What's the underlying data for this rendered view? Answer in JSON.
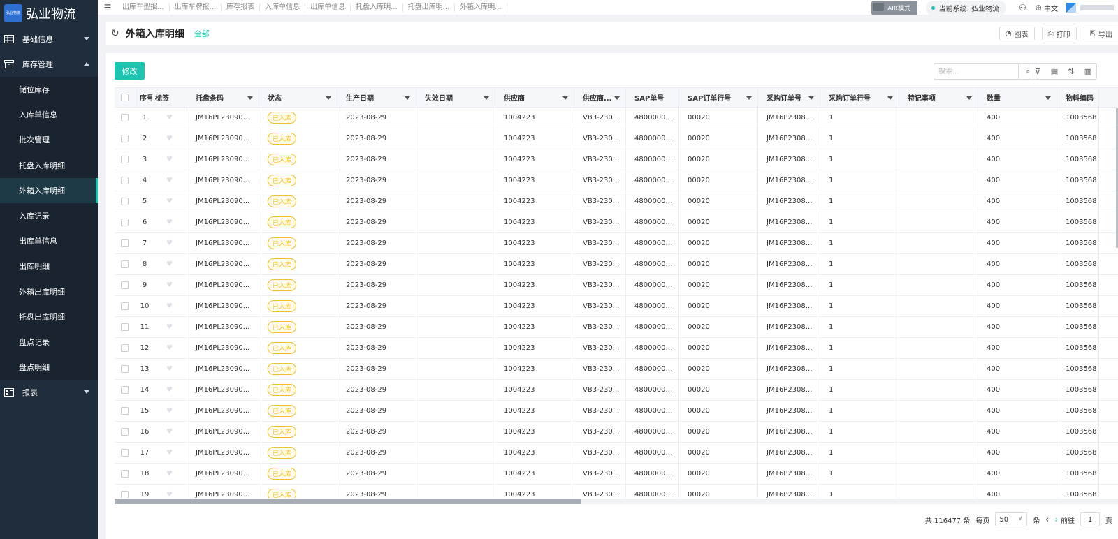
{
  "app": {
    "logo_mark": "弘业物流",
    "name": "弘业物流"
  },
  "sidebar": {
    "groups": [
      {
        "label": "基础信息",
        "expanded": false
      },
      {
        "label": "库存管理",
        "expanded": true
      },
      {
        "label": "报表",
        "expanded": false
      }
    ],
    "items": [
      {
        "label": "储位库存"
      },
      {
        "label": "入库单信息"
      },
      {
        "label": "批次管理"
      },
      {
        "label": "托盘入库明细"
      },
      {
        "label": "外箱入库明细",
        "active": true
      },
      {
        "label": "入库记录"
      },
      {
        "label": "出库单信息"
      },
      {
        "label": "出库明细"
      },
      {
        "label": "外箱出库明细"
      },
      {
        "label": "托盘出库明细"
      },
      {
        "label": "盘点记录"
      },
      {
        "label": "盘点明细"
      }
    ]
  },
  "topbar": {
    "tabs": [
      "出库车型报...",
      "出库车牌报...",
      "库存报表",
      "入库单信息",
      "出库单信息",
      "托盘入库明...",
      "托盘出库明...",
      "外箱入库明..."
    ],
    "air_mode": "AIR模式",
    "current_system": "当前系统: 弘业物流",
    "language": "中文"
  },
  "page": {
    "title": "外箱入库明细",
    "filter": "全部",
    "actions": {
      "chart": "图表",
      "print": "打印",
      "export": "导出"
    },
    "edit_button": "修改",
    "search_placeholder": "搜索..."
  },
  "table": {
    "columns": [
      "序号",
      "标签",
      "托盘条码",
      "状态",
      "生产日期",
      "失效日期",
      "供应商",
      "供应商...",
      "SAP单号",
      "SAP订单行号",
      "采购订单号",
      "采购订单行号",
      "特记事项",
      "数量",
      "物料编码"
    ],
    "rows": [
      [
        "1",
        "JM16PL23090...",
        "已入库",
        "2023-08-29",
        "",
        "1004223",
        "VB3-230...",
        "4800000...",
        "00020",
        "JM16P2308...",
        "1",
        "",
        "400",
        "1003568"
      ],
      [
        "2",
        "JM16PL23090...",
        "已入库",
        "2023-08-29",
        "",
        "1004223",
        "VB3-230...",
        "4800000...",
        "00020",
        "JM16P2308...",
        "1",
        "",
        "400",
        "1003568"
      ],
      [
        "3",
        "JM16PL23090...",
        "已入库",
        "2023-08-29",
        "",
        "1004223",
        "VB3-230...",
        "4800000...",
        "00020",
        "JM16P2308...",
        "1",
        "",
        "400",
        "1003568"
      ],
      [
        "4",
        "JM16PL23090...",
        "已入库",
        "2023-08-29",
        "",
        "1004223",
        "VB3-230...",
        "4800000...",
        "00020",
        "JM16P2308...",
        "1",
        "",
        "400",
        "1003568"
      ],
      [
        "5",
        "JM16PL23090...",
        "已入库",
        "2023-08-29",
        "",
        "1004223",
        "VB3-230...",
        "4800000...",
        "00020",
        "JM16P2308...",
        "1",
        "",
        "400",
        "1003568"
      ],
      [
        "6",
        "JM16PL23090...",
        "已入库",
        "2023-08-29",
        "",
        "1004223",
        "VB3-230...",
        "4800000...",
        "00020",
        "JM16P2308...",
        "1",
        "",
        "400",
        "1003568"
      ],
      [
        "7",
        "JM16PL23090...",
        "已入库",
        "2023-08-29",
        "",
        "1004223",
        "VB3-230...",
        "4800000...",
        "00020",
        "JM16P2308...",
        "1",
        "",
        "400",
        "1003568"
      ],
      [
        "8",
        "JM16PL23090...",
        "已入库",
        "2023-08-29",
        "",
        "1004223",
        "VB3-230...",
        "4800000...",
        "00020",
        "JM16P2308...",
        "1",
        "",
        "400",
        "1003568"
      ],
      [
        "9",
        "JM16PL23090...",
        "已入库",
        "2023-08-29",
        "",
        "1004223",
        "VB3-230...",
        "4800000...",
        "00020",
        "JM16P2308...",
        "1",
        "",
        "400",
        "1003568"
      ],
      [
        "10",
        "JM16PL23090...",
        "已入库",
        "2023-08-29",
        "",
        "1004223",
        "VB3-230...",
        "4800000...",
        "00020",
        "JM16P2308...",
        "1",
        "",
        "400",
        "1003568"
      ],
      [
        "11",
        "JM16PL23090...",
        "已入库",
        "2023-08-29",
        "",
        "1004223",
        "VB3-230...",
        "4800000...",
        "00020",
        "JM16P2308...",
        "1",
        "",
        "400",
        "1003568"
      ],
      [
        "12",
        "JM16PL23090...",
        "已入库",
        "2023-08-29",
        "",
        "1004223",
        "VB3-230...",
        "4800000...",
        "00020",
        "JM16P2308...",
        "1",
        "",
        "400",
        "1003568"
      ],
      [
        "13",
        "JM16PL23090...",
        "已入库",
        "2023-08-29",
        "",
        "1004223",
        "VB3-230...",
        "4800000...",
        "00020",
        "JM16P2308...",
        "1",
        "",
        "400",
        "1003568"
      ],
      [
        "14",
        "JM16PL23090...",
        "已入库",
        "2023-08-29",
        "",
        "1004223",
        "VB3-230...",
        "4800000...",
        "00020",
        "JM16P2308...",
        "1",
        "",
        "400",
        "1003568"
      ],
      [
        "15",
        "JM16PL23090...",
        "已入库",
        "2023-08-29",
        "",
        "1004223",
        "VB3-230...",
        "4800000...",
        "00020",
        "JM16P2308...",
        "1",
        "",
        "400",
        "1003568"
      ],
      [
        "16",
        "JM16PL23090...",
        "已入库",
        "2023-08-29",
        "",
        "1004223",
        "VB3-230...",
        "4800000...",
        "00020",
        "JM16P2308...",
        "1",
        "",
        "400",
        "1003568"
      ],
      [
        "17",
        "JM16PL23090...",
        "已入库",
        "2023-08-29",
        "",
        "1004223",
        "VB3-230...",
        "4800000...",
        "00020",
        "JM16P2308...",
        "1",
        "",
        "400",
        "1003568"
      ],
      [
        "18",
        "JM16PL23090...",
        "已入库",
        "2023-08-29",
        "",
        "1004223",
        "VB3-230...",
        "4800000...",
        "00020",
        "JM16P2308...",
        "1",
        "",
        "400",
        "1003568"
      ],
      [
        "19",
        "JM16PL23090...",
        "已入库",
        "2023-08-29",
        "",
        "1004223",
        "VB3-230...",
        "4800000...",
        "00020",
        "JM16P2308...",
        "1",
        "",
        "400",
        "1003568"
      ]
    ]
  },
  "pager": {
    "total_prefix": "共",
    "total": "116477",
    "total_suffix": "条",
    "per_page_label": "每页",
    "per_page": "50",
    "per_page_unit": "条",
    "goto_label": "前往",
    "page": "1",
    "page_unit": "页"
  },
  "colors": {
    "accent": "#1fc4b0",
    "sidebar": "#1f2d3d",
    "badge": "#f0c030"
  }
}
